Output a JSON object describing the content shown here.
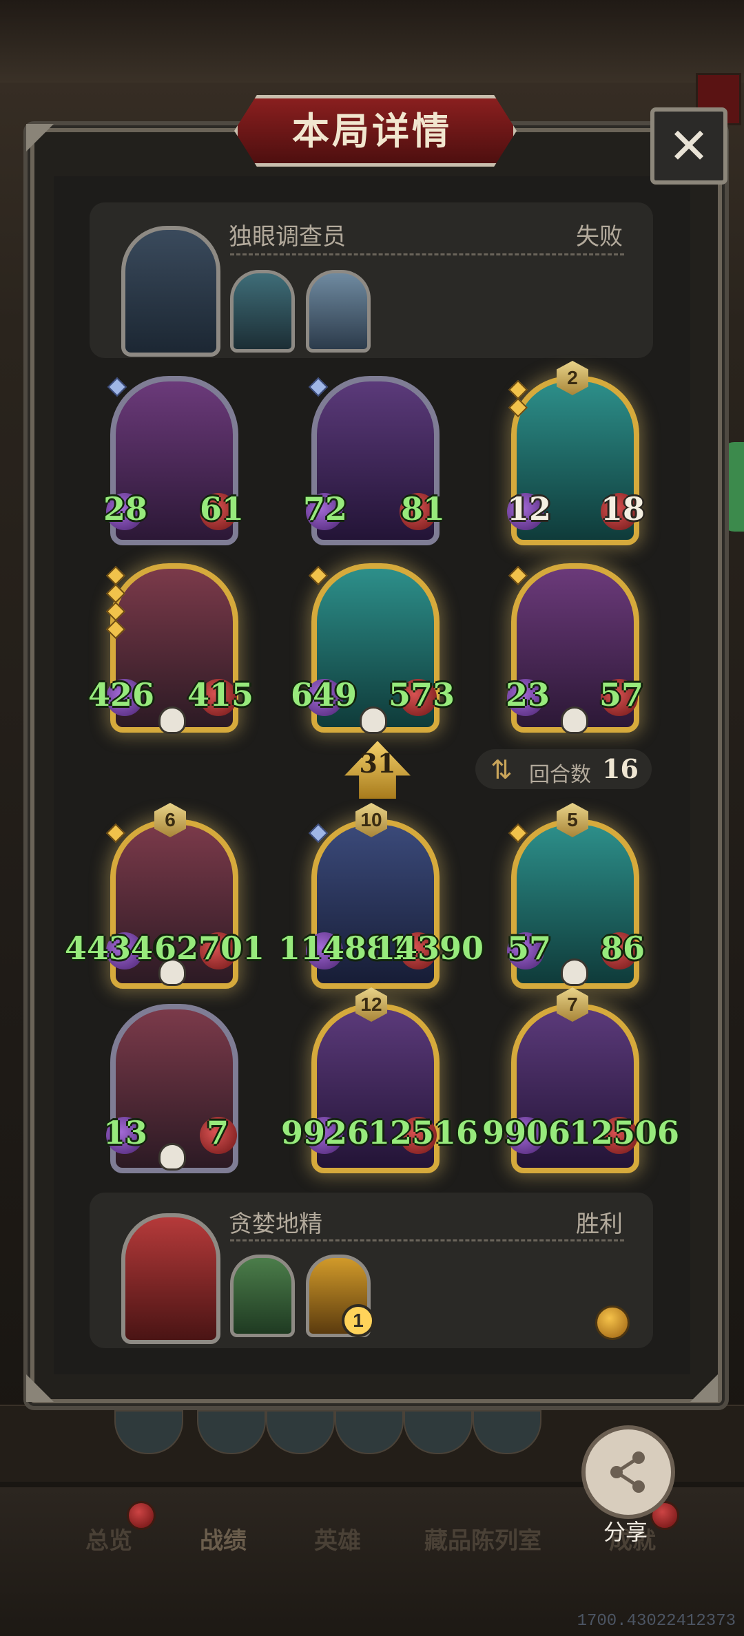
{
  "title": "本局详情",
  "close_label": "✕",
  "players": {
    "top": {
      "name": "独眼调查员",
      "result": "失败"
    },
    "bottom": {
      "name": "贪婪地精",
      "result": "胜利",
      "badge": "1"
    }
  },
  "board_top": [
    {
      "atk": "28",
      "hp": "61"
    },
    {
      "atk": "72",
      "hp": "81"
    },
    {
      "level": "2",
      "atk": "12",
      "hp": "18"
    },
    {
      "atk": "426",
      "hp": "415"
    },
    {
      "atk": "649",
      "hp": "573"
    },
    {
      "atk": "23",
      "hp": "57"
    }
  ],
  "board_bottom": [
    {
      "level": "6",
      "atk": "44346",
      "hp": "62701"
    },
    {
      "level": "10",
      "atk": "114881",
      "hp": "14390"
    },
    {
      "level": "5",
      "atk": "57",
      "hp": "86"
    },
    {
      "atk": "13",
      "hp": "7"
    },
    {
      "level": "12",
      "atk": "9926",
      "hp": "12516"
    },
    {
      "level": "7",
      "atk": "9906",
      "hp": "12506"
    }
  ],
  "damage_badge": "31",
  "round": {
    "label": "回合数",
    "value": "16"
  },
  "share_label": "分享",
  "tabs": [
    "总览",
    "战绩",
    "英雄",
    "藏品陈列室",
    "成就"
  ],
  "version": "1700.43022412373"
}
